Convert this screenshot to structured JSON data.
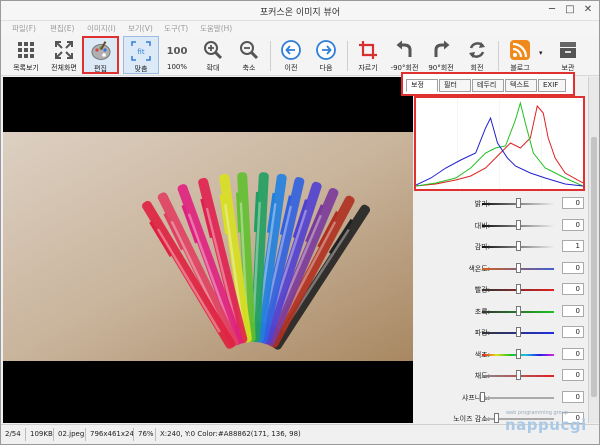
{
  "window": {
    "title": "포커스온 이미지 뷰어",
    "minimize": "─",
    "maximize": "□",
    "close": "✕"
  },
  "menu": [
    "파일(F)",
    "편집(E)",
    "이미지(I)",
    "보기(V)",
    "도구(T)",
    "도움말(H)"
  ],
  "toolbar": [
    {
      "label": "목록보기",
      "icon": "grid-icon"
    },
    {
      "label": "전체화면",
      "icon": "fullscreen-icon"
    },
    {
      "label": "편집",
      "icon": "palette-icon"
    },
    {
      "label": "맞춤",
      "icon": "fit-icon",
      "icon_text": "fit"
    },
    {
      "label": "100%",
      "icon": "actual-size-icon",
      "icon_text": "100"
    },
    {
      "label": "확대",
      "icon": "zoom-in-icon"
    },
    {
      "label": "축소",
      "icon": "zoom-out-icon"
    },
    {
      "label": "이전",
      "icon": "previous-icon"
    },
    {
      "label": "다음",
      "icon": "next-icon"
    },
    {
      "label": "자르기",
      "icon": "crop-icon"
    },
    {
      "label": "-90°회전",
      "icon": "rotate-left-icon"
    },
    {
      "label": "90°회전",
      "icon": "rotate-right-icon"
    },
    {
      "label": "회전",
      "icon": "rotate-icon"
    },
    {
      "label": "블로그",
      "icon": "rss-icon"
    },
    {
      "label": "보관",
      "icon": "archive-icon"
    }
  ],
  "tabs": [
    "보정",
    "필터",
    "테두리",
    "텍스트",
    "EXIF"
  ],
  "adjustments": [
    {
      "name": "밝기:",
      "value": "0",
      "level": 0.5
    },
    {
      "name": "대비:",
      "value": "0",
      "level": 0.5
    },
    {
      "name": "감마:",
      "value": "1",
      "level": 0.5
    },
    {
      "name": "색온도:",
      "value": "0",
      "level": 0.5
    },
    {
      "name": "빨강:",
      "value": "0",
      "level": 0.5
    },
    {
      "name": "초록:",
      "value": "0",
      "level": 0.5
    },
    {
      "name": "파랑:",
      "value": "0",
      "level": 0.5
    },
    {
      "name": "색조:",
      "value": "0",
      "level": 0.5
    },
    {
      "name": "채도:",
      "value": "0",
      "level": 0.5
    },
    {
      "name": "샤프니스:",
      "value": "0",
      "level": 0.0
    },
    {
      "name": "노이즈 감소:",
      "value": "0",
      "level": 0.2
    }
  ],
  "status": {
    "index": "2/54",
    "filesize": "109KB",
    "filename": "02.jpeg",
    "dimensions": "796x461x24",
    "zoom": "76%",
    "pixel": "X:240, Y:0 Color:#A88862(171, 136, 98)"
  },
  "watermark": {
    "logo": "nappucgi",
    "sub": "web programming group"
  },
  "colors": {
    "red_highlight": "#e03030",
    "accent_blue": "#2f7fd8",
    "histogram_red": "#e02020",
    "histogram_green": "#20c020",
    "histogram_blue": "#2020d0"
  }
}
